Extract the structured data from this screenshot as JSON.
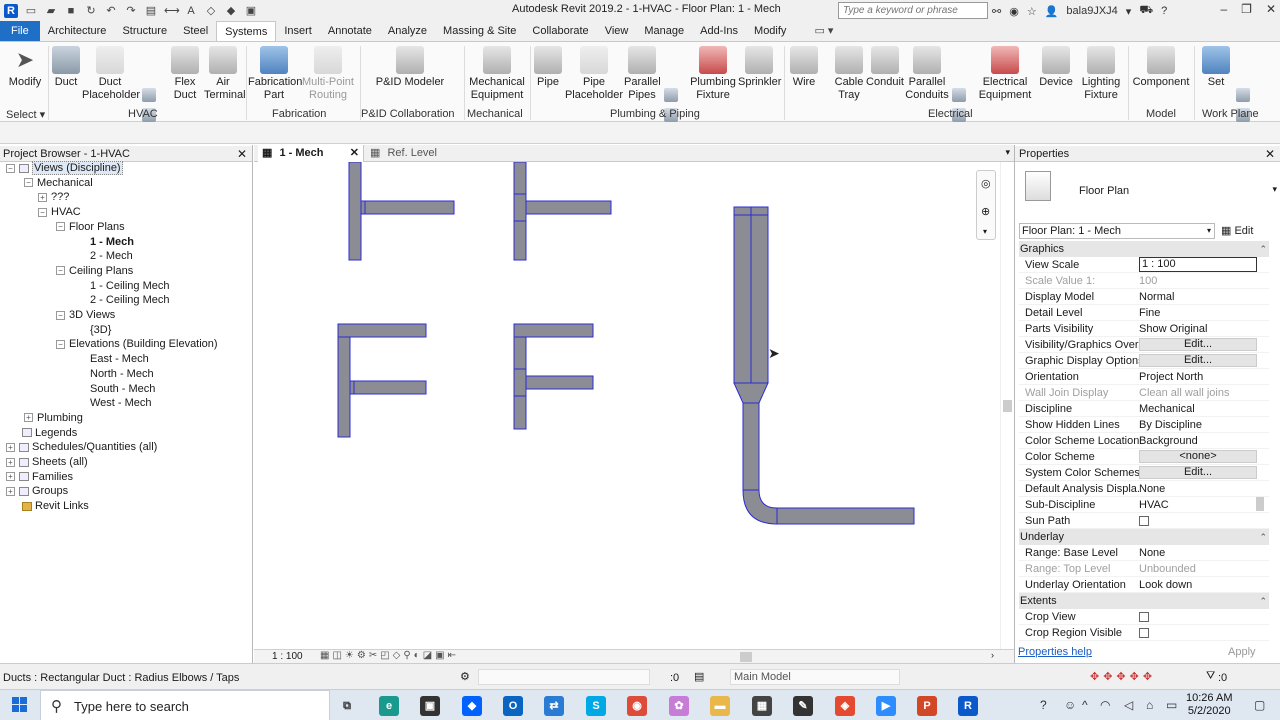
{
  "window": {
    "title": "Autodesk Revit 2019.2 - 1-HVAC - Floor Plan: 1 - Mech",
    "search_placeholder": "Type a keyword or phrase",
    "user": "bala9JXJ4"
  },
  "tabs": [
    {
      "label": "File",
      "kind": "file"
    },
    {
      "label": "Architecture"
    },
    {
      "label": "Structure"
    },
    {
      "label": "Steel"
    },
    {
      "label": "Systems",
      "kind": "active"
    },
    {
      "label": "Insert"
    },
    {
      "label": "Annotate"
    },
    {
      "label": "Analyze"
    },
    {
      "label": "Massing & Site"
    },
    {
      "label": "Collaborate"
    },
    {
      "label": "View"
    },
    {
      "label": "Manage"
    },
    {
      "label": "Add-Ins"
    },
    {
      "label": "Modify"
    }
  ],
  "ribbon": {
    "buttons": {
      "modify": "Modify",
      "duct": "Duct",
      "duct_placeholder": "Duct Placeholder",
      "flex_duct": "Flex Duct",
      "air_terminal": "Air Terminal",
      "fabrication_part": "Fabrication Part",
      "multipoint_routing": "Multi-Point Routing",
      "pid_modeler": "P&ID Modeler",
      "mechanical_equipment": "Mechanical Equipment",
      "pipe": "Pipe",
      "pipe_placeholder": "Pipe Placeholder",
      "parallel_pipes": "Parallel Pipes",
      "plumbing_fixture": "Plumbing Fixture",
      "sprinkler": "Sprinkler",
      "wire": "Wire",
      "cable_tray": "Cable Tray",
      "conduit": "Conduit",
      "parallel_conduits": "Parallel Conduits",
      "electrical_equipment": "Electrical Equipment",
      "device": "Device",
      "lighting_fixture": "Lighting Fixture",
      "component": "Component",
      "set": "Set"
    },
    "panels": {
      "select": "Select",
      "hvac": "HVAC",
      "fabrication": "Fabrication",
      "pid": "P&ID Collaboration",
      "mechanical": "Mechanical",
      "plumbing": "Plumbing & Piping",
      "electrical": "Electrical",
      "model": "Model",
      "workplane": "Work Plane"
    }
  },
  "project_browser": {
    "title": "Project Browser - 1-HVAC",
    "items": [
      {
        "label": "Views (Discipline)",
        "level": 0,
        "toggle": "-",
        "icon": "views",
        "highlight": true
      },
      {
        "label": "Mechanical",
        "level": 1,
        "toggle": "-"
      },
      {
        "label": "???",
        "level": 2,
        "toggle": "+"
      },
      {
        "label": "HVAC",
        "level": 2,
        "toggle": "-"
      },
      {
        "label": "Floor Plans",
        "level": 3,
        "toggle": "-"
      },
      {
        "label": "1 - Mech",
        "level": 4,
        "selected": true
      },
      {
        "label": "2 - Mech",
        "level": 4
      },
      {
        "label": "Ceiling Plans",
        "level": 3,
        "toggle": "-"
      },
      {
        "label": "1 - Ceiling Mech",
        "level": 4
      },
      {
        "label": "2 - Ceiling Mech",
        "level": 4
      },
      {
        "label": "3D Views",
        "level": 3,
        "toggle": "-"
      },
      {
        "label": "{3D}",
        "level": 4
      },
      {
        "label": "Elevations (Building Elevation)",
        "level": 3,
        "toggle": "-"
      },
      {
        "label": "East - Mech",
        "level": 4
      },
      {
        "label": "North - Mech",
        "level": 4
      },
      {
        "label": "South - Mech",
        "level": 4
      },
      {
        "label": "West - Mech",
        "level": 4
      },
      {
        "label": "Plumbing",
        "level": 1,
        "toggle": "+"
      },
      {
        "label": "Legends",
        "level": 0,
        "icon": "legend"
      },
      {
        "label": "Schedules/Quantities (all)",
        "level": 0,
        "toggle": "+",
        "icon": "schedule"
      },
      {
        "label": "Sheets (all)",
        "level": 0,
        "toggle": "+",
        "icon": "sheet"
      },
      {
        "label": "Families",
        "level": 0,
        "toggle": "+",
        "icon": "family"
      },
      {
        "label": "Groups",
        "level": 0,
        "toggle": "+",
        "icon": "group"
      },
      {
        "label": "Revit Links",
        "level": 0,
        "icon": "link"
      }
    ]
  },
  "view_tabs": [
    {
      "label": "1 - Mech",
      "active": true
    },
    {
      "label": "Ref. Level",
      "active": false
    }
  ],
  "view_scale": "1 : 100",
  "properties": {
    "title": "Properties",
    "type_name": "Floor Plan",
    "instance": "Floor Plan: 1 - Mech",
    "edit_type": "Edit Type",
    "sections": [
      {
        "name": "Graphics",
        "rows": [
          {
            "key": "View Scale",
            "value": "1 : 100",
            "style": "input"
          },
          {
            "key": "Scale Value    1:",
            "value": "100",
            "style": "disabled"
          },
          {
            "key": "Display Model",
            "value": "Normal"
          },
          {
            "key": "Detail Level",
            "value": "Fine"
          },
          {
            "key": "Parts Visibility",
            "value": "Show Original"
          },
          {
            "key": "Visibility/Graphics Over...",
            "value": "Edit...",
            "style": "button"
          },
          {
            "key": "Graphic Display Options",
            "value": "Edit...",
            "style": "button"
          },
          {
            "key": "Orientation",
            "value": "Project North"
          },
          {
            "key": "Wall Join Display",
            "value": "Clean all wall joins",
            "style": "disabled"
          },
          {
            "key": "Discipline",
            "value": "Mechanical"
          },
          {
            "key": "Show Hidden Lines",
            "value": "By Discipline"
          },
          {
            "key": "Color Scheme Location",
            "value": "Background"
          },
          {
            "key": "Color Scheme",
            "value": "<none>",
            "style": "button"
          },
          {
            "key": "System Color Schemes",
            "value": "Edit...",
            "style": "button"
          },
          {
            "key": "Default Analysis Displa...",
            "value": "None"
          },
          {
            "key": "Sub-Discipline",
            "value": "HVAC"
          },
          {
            "key": "Sun Path",
            "value": "",
            "style": "checkbox"
          }
        ]
      },
      {
        "name": "Underlay",
        "rows": [
          {
            "key": "Range: Base Level",
            "value": "None"
          },
          {
            "key": "Range: Top Level",
            "value": "Unbounded",
            "style": "disabled"
          },
          {
            "key": "Underlay Orientation",
            "value": "Look down"
          }
        ]
      },
      {
        "name": "Extents",
        "rows": [
          {
            "key": "Crop View",
            "value": "",
            "style": "checkbox"
          },
          {
            "key": "Crop Region Visible",
            "value": "",
            "style": "checkbox"
          }
        ]
      }
    ],
    "help_link": "Properties help",
    "apply": "Apply"
  },
  "status": {
    "text": "Ducts : Rectangular Duct : Radius Elbows / Taps",
    "zero": ":0",
    "model": "Main Model",
    "filter_count": ":0"
  },
  "taskbar": {
    "search_placeholder": "Type here to search",
    "time": "10:26 AM",
    "date": "5/2/2020"
  },
  "colors": {
    "duct_fill": "#8c8c94",
    "duct_edge": "#2b2bd6",
    "file_tab": "#1f6fc7",
    "link": "#1a5ec2"
  }
}
